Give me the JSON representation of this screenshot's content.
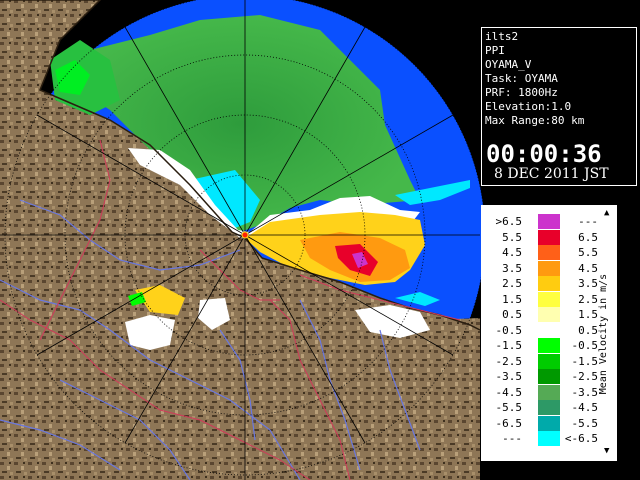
{
  "info": {
    "lines": [
      "ilts2",
      "PPI",
      "OYAMA_V",
      "Task: OYAMA",
      "PRF: 1800Hz",
      "Elevation:1.0",
      "Max Range:80 km"
    ],
    "time": "00:00:36",
    "date": "8 DEC 2011 JST"
  },
  "legend": {
    "title": "Mean Velocity in m/s",
    "rows": [
      {
        "lo": ">6.5",
        "hi": "---",
        "color": "#cc33cc"
      },
      {
        "lo": "5.5",
        "hi": "6.5",
        "color": "#e8002a"
      },
      {
        "lo": "4.5",
        "hi": "5.5",
        "color": "#ff6018"
      },
      {
        "lo": "3.5",
        "hi": "4.5",
        "color": "#ff9a10"
      },
      {
        "lo": "2.5",
        "hi": "3.5",
        "color": "#ffcc10"
      },
      {
        "lo": "1.5",
        "hi": "2.5",
        "color": "#ffff40"
      },
      {
        "lo": "0.5",
        "hi": "1.5",
        "color": "#ffffb0"
      },
      {
        "lo": "-0.5",
        "hi": "0.5",
        "color": "#ffffff"
      },
      {
        "lo": "-1.5",
        "hi": "-0.5",
        "color": "#00ff00"
      },
      {
        "lo": "-2.5",
        "hi": "-1.5",
        "color": "#00cc00"
      },
      {
        "lo": "-3.5",
        "hi": "-2.5",
        "color": "#009900"
      },
      {
        "lo": "-4.5",
        "hi": "-3.5",
        "color": "#55aa55"
      },
      {
        "lo": "-5.5",
        "hi": "-4.5",
        "color": "#2d9966"
      },
      {
        "lo": "-6.5",
        "hi": "-5.5",
        "color": "#00aaaa"
      },
      {
        "lo": "---",
        "hi": "<-6.5",
        "color": "#00ffff"
      }
    ]
  },
  "colors": {
    "sea": "#0050ff",
    "land": "#8b7355",
    "rivers": "#6a78e0",
    "borders": "#d03a5a",
    "range_rings": "#000000"
  }
}
